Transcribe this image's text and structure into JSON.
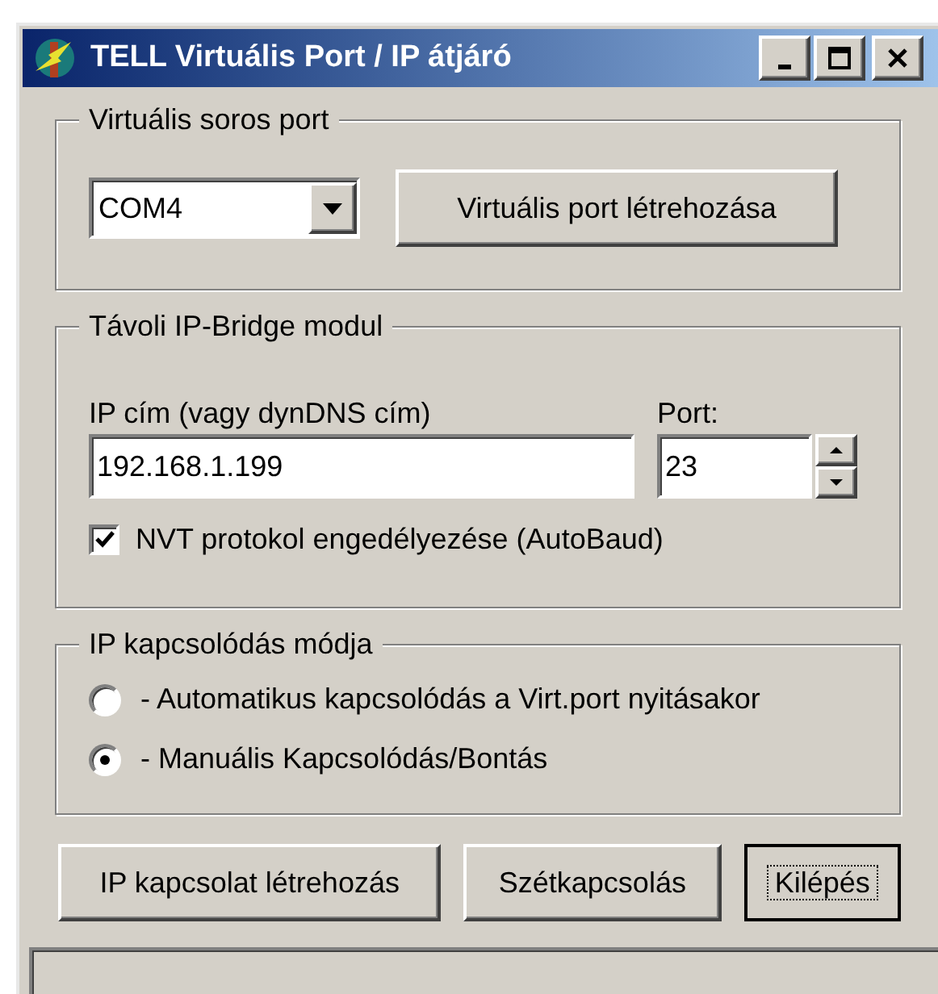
{
  "window": {
    "title": "TELL Virtuális Port / IP átjáró"
  },
  "virtual_port": {
    "legend": "Virtuális soros port",
    "port_select": {
      "value": "COM4"
    },
    "create_button": "Virtuális port létrehozása"
  },
  "remote_module": {
    "legend": "Távoli IP-Bridge modul",
    "ip_label": "IP cím (vagy dynDNS cím)",
    "ip_field": {
      "value": "192.168.1.199"
    },
    "port_label": "Port:",
    "port_field": {
      "value": "23"
    },
    "nvt_checkbox": {
      "label": "NVT protokol engedélyezése (AutoBaud)",
      "checked": true
    }
  },
  "connection_mode": {
    "legend": "IP kapcsolódás módja",
    "options": [
      {
        "label": "- Automatikus kapcsolódás a Virt.port nyitásakor",
        "selected": false
      },
      {
        "label": "- Manuális Kapcsolódás/Bontás",
        "selected": true
      }
    ]
  },
  "buttons": [
    {
      "label": "IP kapcsolat létrehozás",
      "focused": false
    },
    {
      "label": "Szétkapcsolás",
      "focused": false
    },
    {
      "label": "Kilépés",
      "focused": true
    }
  ]
}
